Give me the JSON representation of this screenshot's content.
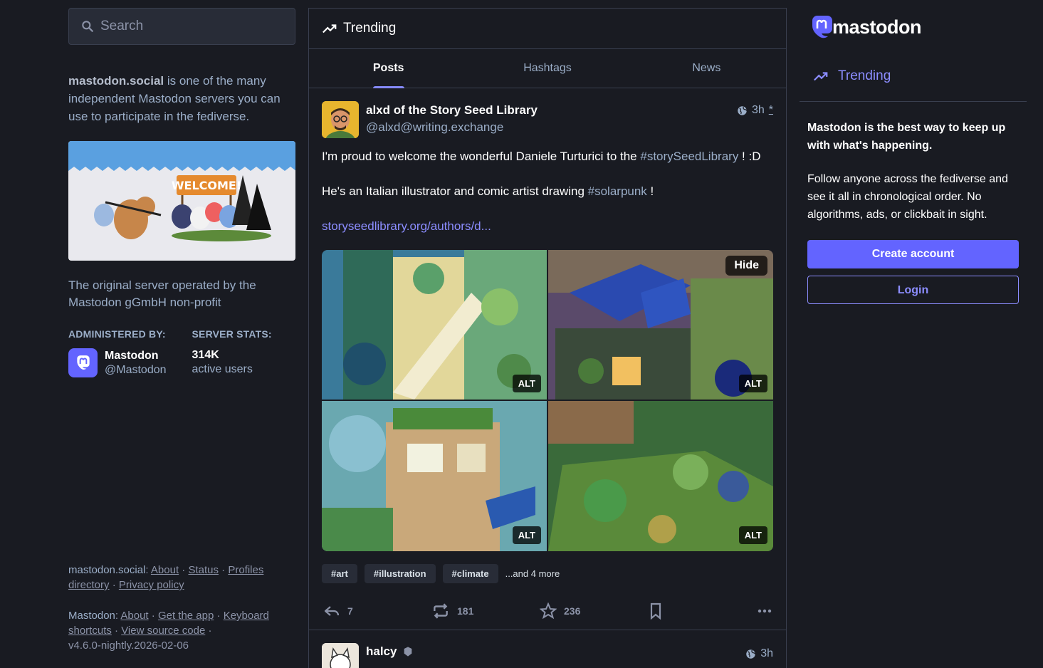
{
  "search": {
    "placeholder": "Search"
  },
  "server_about": {
    "server_name": "mastodon.social",
    "text": " is one of the many independent Mastodon servers you can use to participate in the fediverse."
  },
  "hero_banner": {
    "text": "WELCOME!"
  },
  "server_description": "The original server operated by the Mastodon gGmbH non-profit",
  "administered_by": {
    "heading": "ADMINISTERED BY:",
    "name": "Mastodon",
    "handle": "@Mastodon"
  },
  "server_stats": {
    "heading": "SERVER STATS:",
    "value": "314K",
    "label": "active users"
  },
  "footer": {
    "server": {
      "title": "mastodon.social",
      "sep": ": ",
      "links": [
        "About",
        "Status",
        "Profiles directory",
        "Privacy policy"
      ]
    },
    "mastodon": {
      "title": "Mastodon",
      "sep": ": ",
      "links": [
        "About",
        "Get the app",
        "Keyboard shortcuts",
        "View source code"
      ],
      "version": "v4.6.0-nightly.2026-02-06"
    }
  },
  "column": {
    "title": "Trending",
    "tabs": [
      "Posts",
      "Hashtags",
      "News"
    ],
    "active_tab": "Posts"
  },
  "post": {
    "author_name": "alxd of the Story Seed Library",
    "author_handle": "@alxd@writing.exchange",
    "time": "3h",
    "edited_marker": "*",
    "paragraphs": {
      "p1_a": "I'm proud to welcome the wonderful Daniele Turturici to the ",
      "p1_tag": "#storySeedLibrary",
      "p1_b": " ! :D",
      "p2_a": "He's an Italian illustrator and comic artist drawing ",
      "p2_tag": "#solarpunk",
      "p2_b": " !",
      "link": "storyseedlibrary.org/authors/d..."
    },
    "media_hide_label": "Hide",
    "media_alt_label": "ALT",
    "hashtags": [
      "#art",
      "#illustration",
      "#climate"
    ],
    "more_tags": "...and 4 more",
    "replies": "7",
    "boosts": "181",
    "favourites": "236"
  },
  "post2": {
    "author_name": "halcy",
    "time": "3h"
  },
  "right": {
    "logo_text": "mastodon",
    "nav_trending": "Trending",
    "pitch_strong": "Mastodon is the best way to keep up with what's happening.",
    "pitch_text": "Follow anyone across the fediverse and see it all in chronological order. No algorithms, ads, or clickbait in sight.",
    "create_account": "Create account",
    "login": "Login"
  },
  "colors": {
    "background": "#191b22",
    "accent": "#6364ff",
    "link": "#8c8dff",
    "border": "#393f4f"
  }
}
